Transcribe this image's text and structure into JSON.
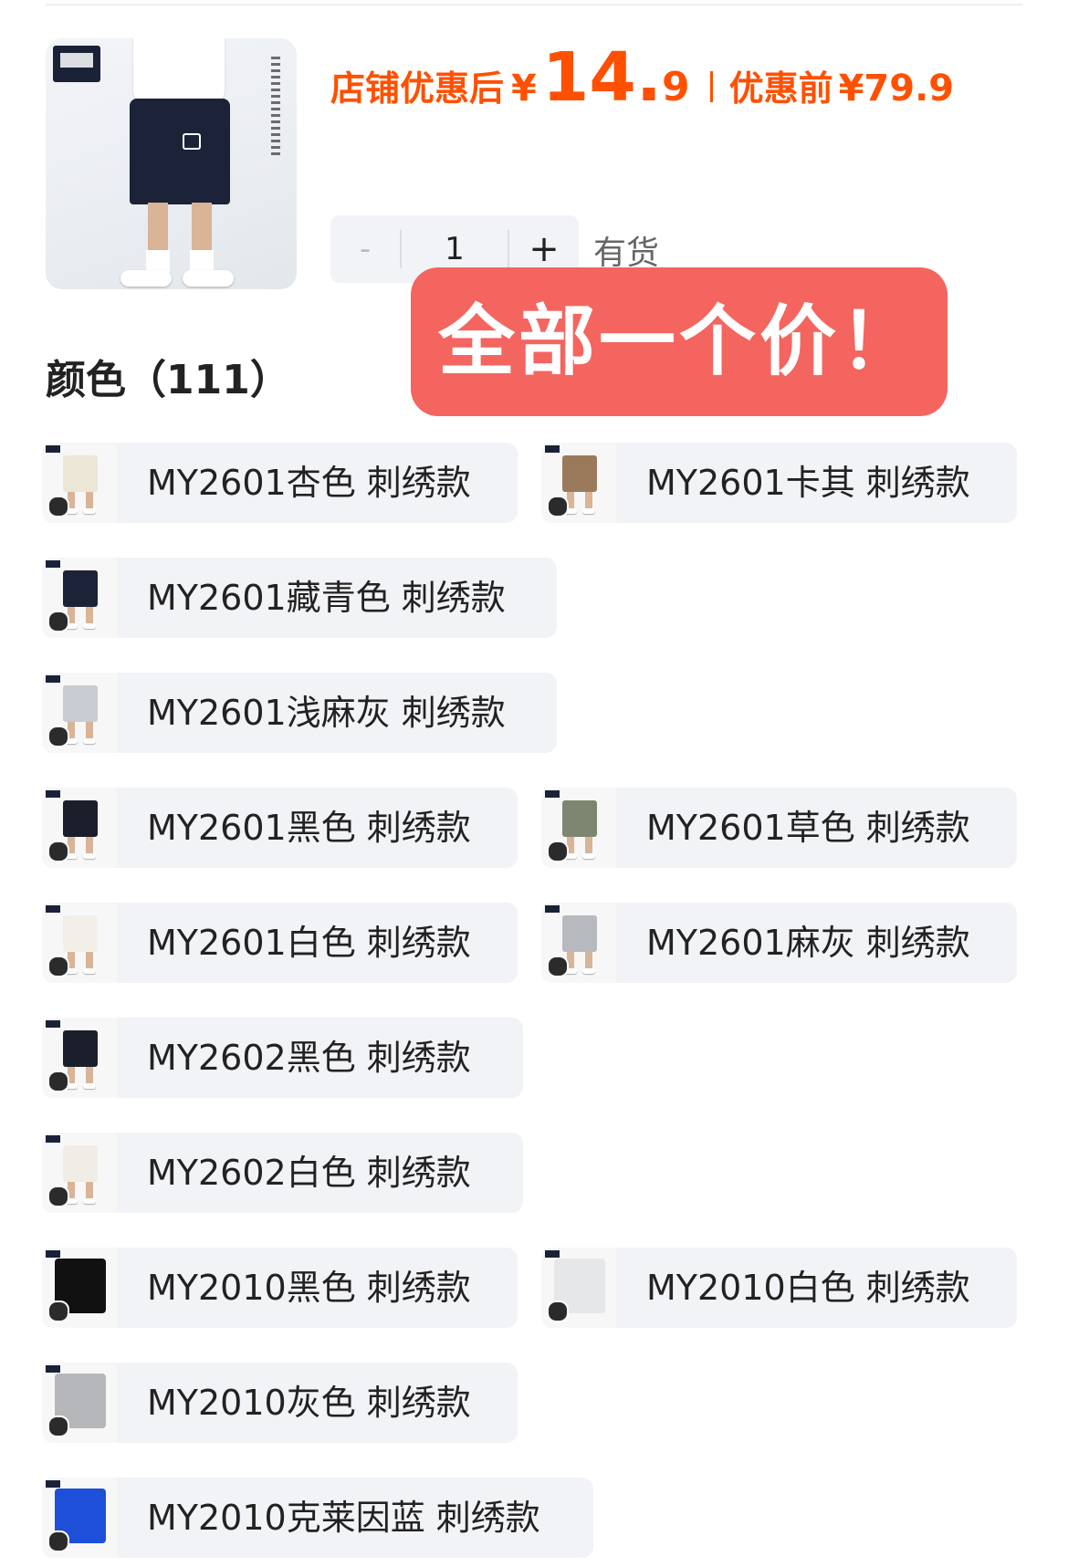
{
  "price": {
    "label": "店铺优惠后",
    "currency": "¥",
    "integer": "14.",
    "decimal": "9",
    "original_label": "优惠前",
    "original": "¥79.9",
    "color": "#ff5000"
  },
  "quantity": {
    "minus": "-",
    "value": "1",
    "plus": "+"
  },
  "stock": "有货",
  "banner": {
    "text": "全部一个价！",
    "color": "#f4655f"
  },
  "section_title": "颜色（111）",
  "options": [
    {
      "label": "MY2601杏色 刺绣款",
      "color": "#ece6d6"
    },
    {
      "label": "MY2601卡其 刺绣款",
      "color": "#9a7a5a"
    },
    {
      "label": "MY2601藏青色 刺绣款",
      "color": "#1c2237"
    },
    {
      "label": "MY2601浅麻灰 刺绣款",
      "color": "#c9ccd2"
    },
    {
      "label": "MY2601黑色 刺绣款",
      "color": "#1b1f2b"
    },
    {
      "label": "MY2601草色 刺绣款",
      "color": "#7d8670"
    },
    {
      "label": "MY2601白色 刺绣款",
      "color": "#f1efe8"
    },
    {
      "label": "MY2601麻灰 刺绣款",
      "color": "#b6b9be"
    },
    {
      "label": "MY2602黑色 刺绣款",
      "color": "#1b1f2b"
    },
    {
      "label": "MY2602白色 刺绣款",
      "color": "#f0ede6"
    },
    {
      "label": "MY2010黑色 刺绣款",
      "color": "#111111"
    },
    {
      "label": "MY2010白色 刺绣款",
      "color": "#e6e7e9"
    },
    {
      "label": "MY2010灰色 刺绣款",
      "color": "#b5b7bb"
    },
    {
      "label": "MY2010克莱因蓝 刺绣款",
      "color": "#1d4fd8"
    }
  ]
}
